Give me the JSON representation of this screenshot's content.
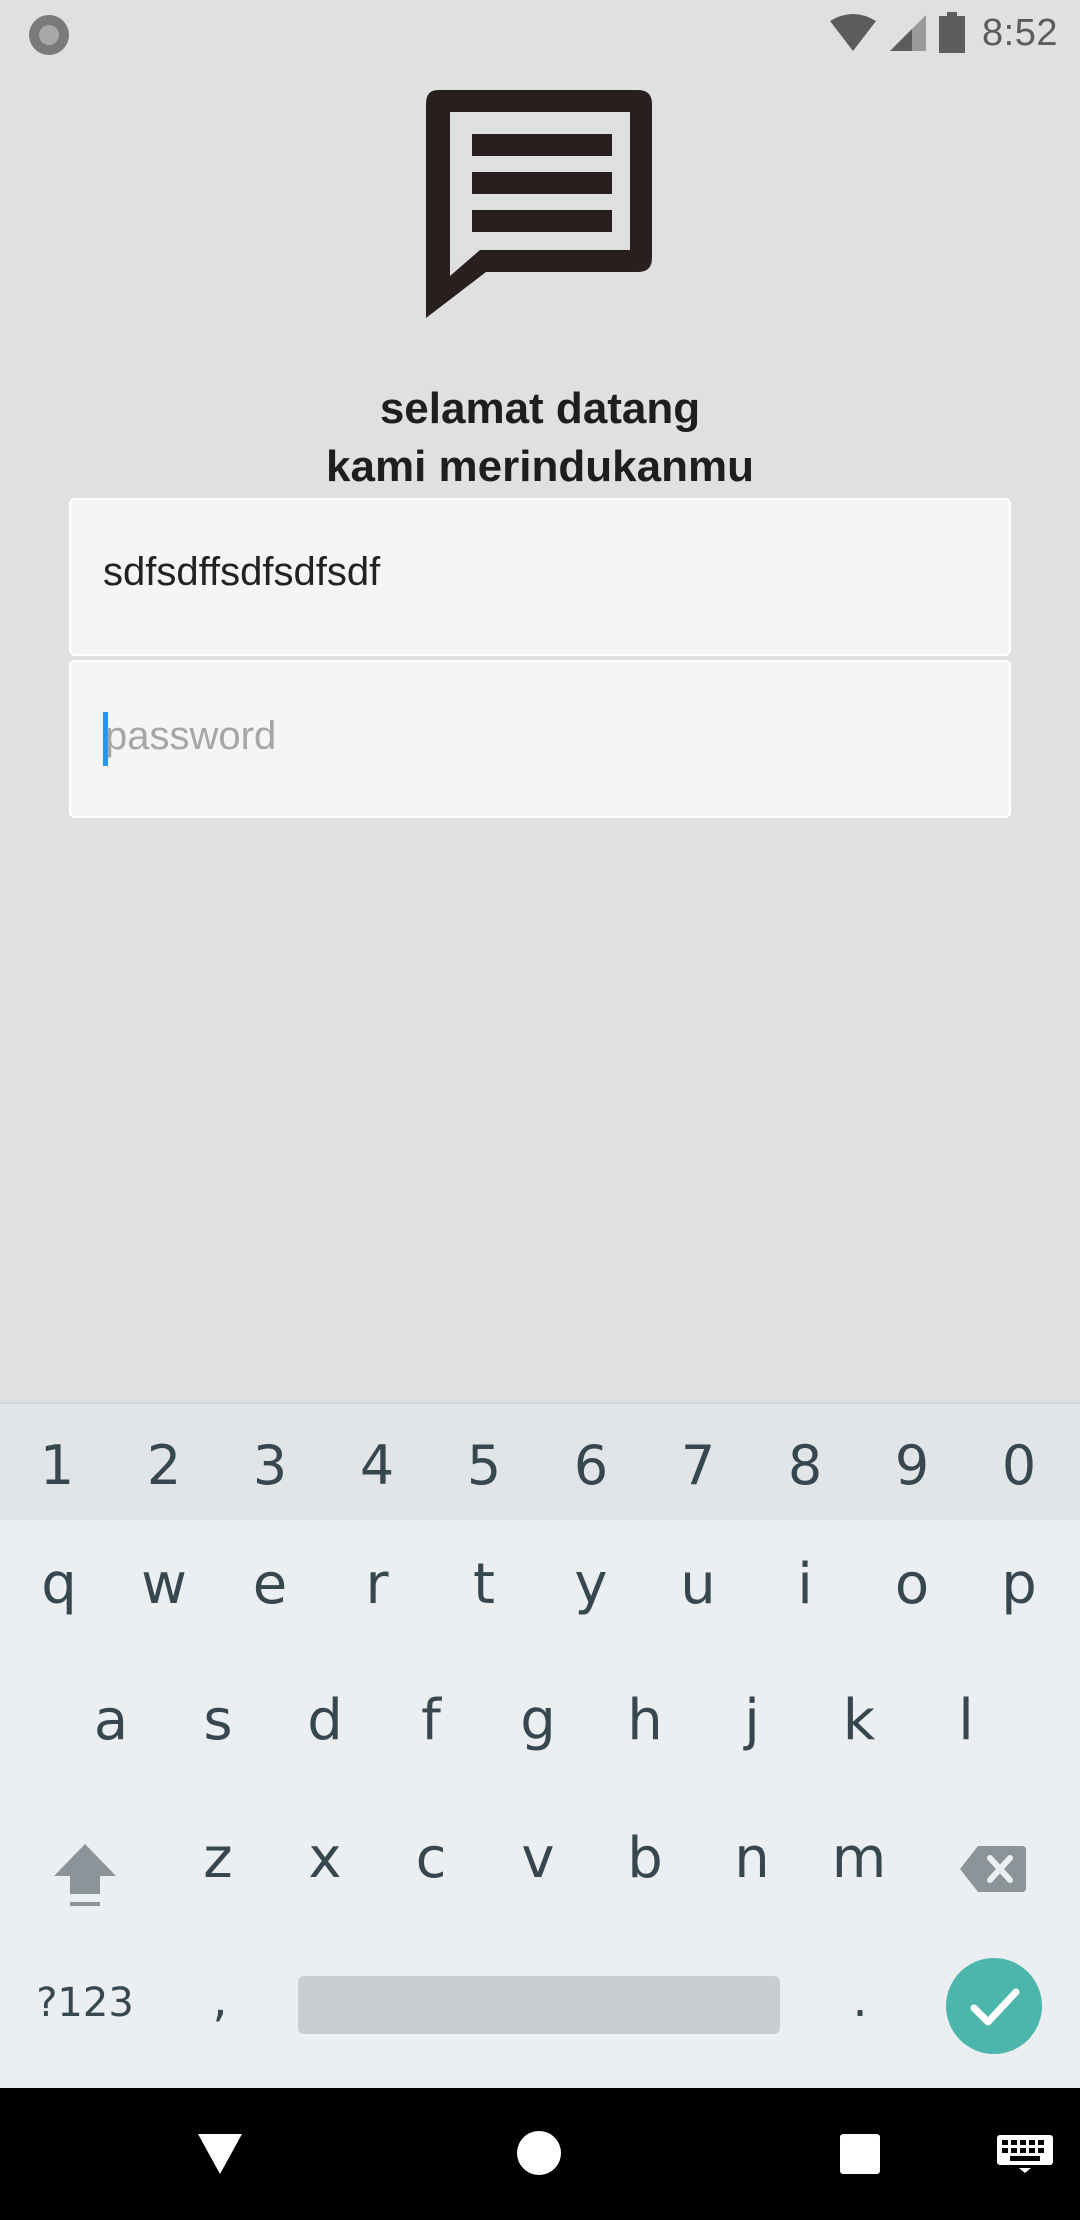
{
  "status_bar": {
    "time": "8:52",
    "icons": [
      "notification-dot-icon",
      "wifi-icon",
      "signal-icon",
      "battery-icon"
    ]
  },
  "app": {
    "logo_icon": "message-lines-icon",
    "welcome_line1": "selamat datang",
    "welcome_line2": "kami merindukanmu"
  },
  "form": {
    "username_value": "sdfsdffsdfsdfsdf",
    "password_placeholder": "password"
  },
  "keyboard": {
    "number_row": [
      "1",
      "2",
      "3",
      "4",
      "5",
      "6",
      "7",
      "8",
      "9",
      "0"
    ],
    "row1": [
      "q",
      "w",
      "e",
      "r",
      "t",
      "y",
      "u",
      "i",
      "o",
      "p"
    ],
    "row2": [
      "a",
      "s",
      "d",
      "f",
      "g",
      "h",
      "j",
      "k",
      "l"
    ],
    "row3": [
      "z",
      "x",
      "c",
      "v",
      "b",
      "n",
      "m"
    ],
    "symbols_key": "?123",
    "comma_key": ",",
    "period_key": ".",
    "accent_color": "#4db6ac"
  },
  "nav_bar": {
    "icons": [
      "back-icon",
      "home-icon",
      "recents-icon",
      "keyboard-switch-icon"
    ]
  }
}
